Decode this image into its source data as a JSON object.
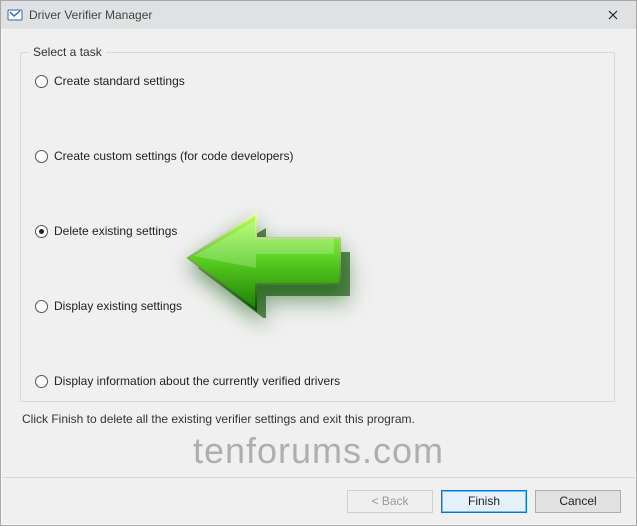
{
  "window": {
    "title": "Driver Verifier Manager"
  },
  "group": {
    "legend": "Select a task"
  },
  "options": [
    {
      "id": "opt-standard",
      "label": "Create standard settings",
      "checked": false
    },
    {
      "id": "opt-custom",
      "label": "Create custom settings (for code developers)",
      "checked": false
    },
    {
      "id": "opt-delete",
      "label": "Delete existing settings",
      "checked": true
    },
    {
      "id": "opt-display",
      "label": "Display existing settings",
      "checked": false
    },
    {
      "id": "opt-info",
      "label": "Display information about the currently verified drivers",
      "checked": false
    }
  ],
  "hint": "Click Finish to delete all the existing verifier settings and exit this program.",
  "buttons": {
    "back": "< Back",
    "finish": "Finish",
    "cancel": "Cancel"
  },
  "watermark": "tenforums.com",
  "annotation": {
    "arrow_icon": "green-left-arrow"
  }
}
